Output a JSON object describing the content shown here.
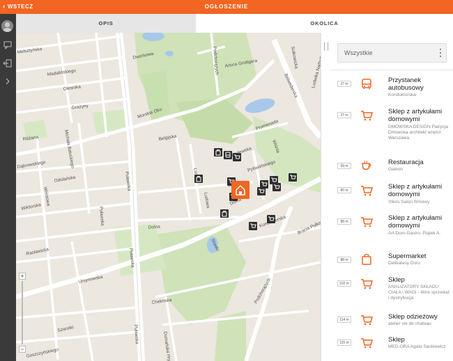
{
  "topbar": {
    "back_label": "WSTECZ",
    "title": "OGŁOSZENIE",
    "color": "#f26522"
  },
  "tabs": {
    "opis": "OPIS",
    "okolica": "OKOLICA"
  },
  "map": {
    "streets": [
      "Melsztyńska",
      "Madaliński",
      "Oleśnika",
      "Grażyny",
      "Różana",
      "Dąbrowskiego",
      "Michała Bałuckiego",
      "Odolańska",
      "Wiśniowa",
      "Wiktorska",
      "Racławicka",
      "Ursynowska",
      "Szarotki",
      "Goszczyńskiego",
      "Morskie Oko",
      "Belgijska",
      "Puławska",
      "Dworkowa",
      "Podchorążych",
      "Artura Grottgera",
      "Promenada",
      "Padewska",
      "Hucuła",
      "Pytlasińskiego",
      "Dolna",
      "Lucka",
      "Ludowa",
      "Jazdów",
      "Chełmska",
      "Belwederska",
      "Sułkowicka",
      "Ludwika Narbutta",
      "Konduktorska",
      "Bracka Pułkowa",
      "Słoneczna",
      "Stępińska",
      "Domańska",
      "Wisłostrada",
      "Podchorążych",
      "Gagarina"
    ],
    "zoom_plus": "+",
    "zoom_minus": "−"
  },
  "filter": {
    "value": "Wszystkie"
  },
  "places": [
    {
      "distance": "27 m",
      "icon": "bus-icon",
      "name": "Przystanek autobusowy",
      "sub": "Konduktorska"
    },
    {
      "distance": "27 m",
      "icon": "cart-icon",
      "name": "Sklep z artykułami domowymi",
      "sub": "DMOWSKA DESIGN Patrycja Dmowska architekt wnętrz Warszawa"
    },
    {
      "distance": "69 m",
      "icon": "coffee-icon",
      "name": "Restauracja",
      "sub": "Galeon"
    },
    {
      "distance": "80 m",
      "icon": "cart-icon",
      "name": "Sklep z artykułami domowymi",
      "sub": "Sferis Salon firmowy"
    },
    {
      "distance": "88 m",
      "icon": "cart-icon",
      "name": "Sklep z artykułami domowymi",
      "sub": "Art-Dom-Gastro. Piątek A."
    },
    {
      "distance": "88 m",
      "icon": "bag-icon",
      "name": "Supermarket",
      "sub": "Delikatesy Doro"
    },
    {
      "distance": "102 m",
      "icon": "cart-icon",
      "name": "Sklep",
      "sub": "ANALIZATORY SKŁADU CIAŁA i WAGI - 4line sprzedaż i dystrybucja"
    },
    {
      "distance": "114 m",
      "icon": "cart-icon",
      "name": "Sklep odzieżowy",
      "sub": "atelier vie de chateau"
    },
    {
      "distance": "115 m",
      "icon": "cart-icon",
      "name": "Sklep",
      "sub": "MED-ORA Agata Sackiewicz"
    }
  ]
}
